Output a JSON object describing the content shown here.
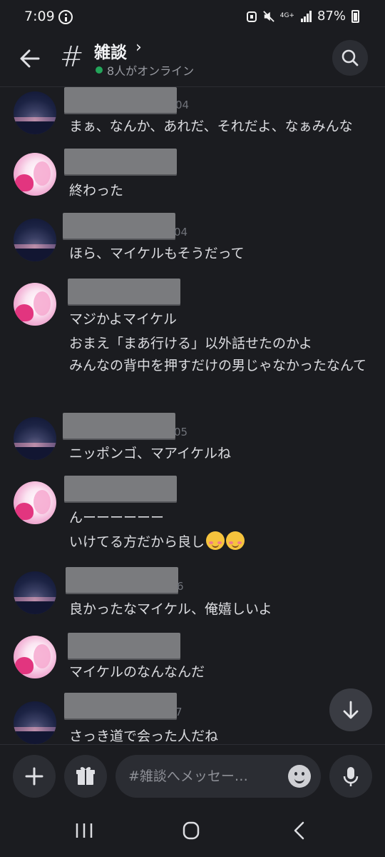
{
  "status_bar": {
    "time": "7:09",
    "network": "4G+",
    "battery": "87%"
  },
  "header": {
    "channel_name": "雑談",
    "title_chevron": "›",
    "hash": "#",
    "online_text": "8人がオンライン"
  },
  "messages": [
    {
      "avatar": "night-sky-avatar",
      "timestamp_fragment": "04",
      "lines": [
        "まぁ、なんか、あれだ、それだよ、なぁみんな"
      ]
    },
    {
      "avatar": "pink-anime-avatar",
      "timestamp_fragment": "",
      "lines": [
        "終わった"
      ]
    },
    {
      "avatar": "night-sky-avatar",
      "timestamp_fragment": "04",
      "lines": [
        "ほら、マイケルもそうだって"
      ]
    },
    {
      "avatar": "pink-anime-avatar",
      "timestamp_fragment": "",
      "lines": [
        "マジかよマイケル",
        "おまえ「まあ行ける」以外話せたのかよ",
        "みんなの背中を押すだけの男じゃなかったなんて"
      ]
    },
    {
      "avatar": "night-sky-avatar",
      "timestamp_fragment": "05",
      "lines": [
        "ニッポンゴ、マアイケルね"
      ]
    },
    {
      "avatar": "pink-anime-avatar",
      "timestamp_fragment": "",
      "lines": [
        "んーーーーーー",
        "いけてる方だから良し"
      ]
    },
    {
      "avatar": "night-sky-avatar",
      "timestamp_fragment": "6",
      "lines": [
        "良かったなマイケル、俺嬉しいよ"
      ]
    },
    {
      "avatar": "pink-anime-avatar",
      "timestamp_fragment": "",
      "lines": [
        "マイケルのなんなんだ"
      ]
    },
    {
      "avatar": "night-sky-avatar",
      "timestamp_fragment": "7",
      "lines": [
        "さっき道で会った人だね"
      ]
    }
  ],
  "composer": {
    "placeholder": "#雑談へメッセー…"
  },
  "icons": {
    "back": "arrow-left-icon",
    "search": "search-icon",
    "jump": "arrow-down-icon",
    "add": "plus-icon",
    "gift": "gift-icon",
    "emoji": "emoji-icon",
    "mic": "microphone-icon",
    "recents": "recents-icon",
    "home": "home-icon",
    "nav_back": "chevron-left-icon"
  },
  "colors": {
    "background": "#1b1c20",
    "online": "#23a55a",
    "surface": "#2b2d33"
  }
}
